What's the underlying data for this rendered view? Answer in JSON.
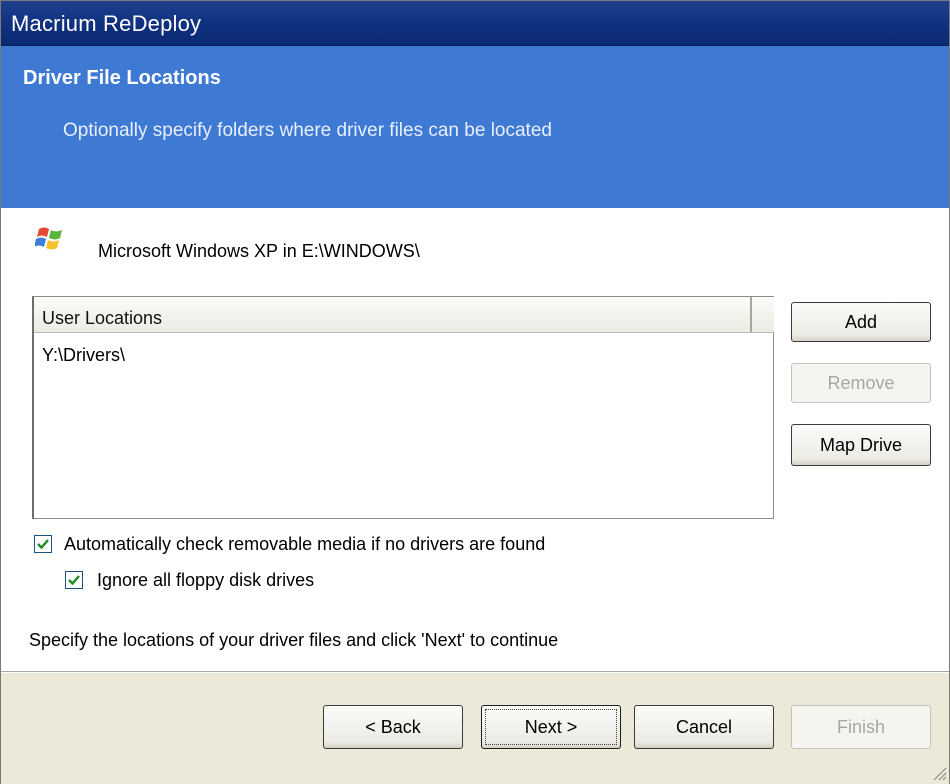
{
  "window": {
    "title": "Macrium ReDeploy"
  },
  "header": {
    "title": "Driver File Locations",
    "subtitle": "Optionally specify folders where driver files can be located"
  },
  "os": {
    "icon": "windows-xp-logo-icon",
    "label": "Microsoft Windows XP in E:\\WINDOWS\\"
  },
  "locations": {
    "column_header": "User Locations",
    "rows": [
      "Y:\\Drivers\\"
    ]
  },
  "side_buttons": {
    "add": "Add",
    "remove": "Remove",
    "map_drive": "Map Drive"
  },
  "options": {
    "auto_check_label": "Automatically check removable media if no drivers are found",
    "auto_check_checked": true,
    "ignore_floppy_label": "Ignore all floppy disk drives",
    "ignore_floppy_checked": true
  },
  "instruction": "Specify the locations of your driver files and click 'Next' to continue",
  "footer_buttons": {
    "back": "< Back",
    "next": "Next >",
    "cancel": "Cancel",
    "finish": "Finish"
  },
  "colors": {
    "title_bar": "#0e2f7e",
    "header_band": "#3e7ad3",
    "footer": "#ece9d8"
  }
}
